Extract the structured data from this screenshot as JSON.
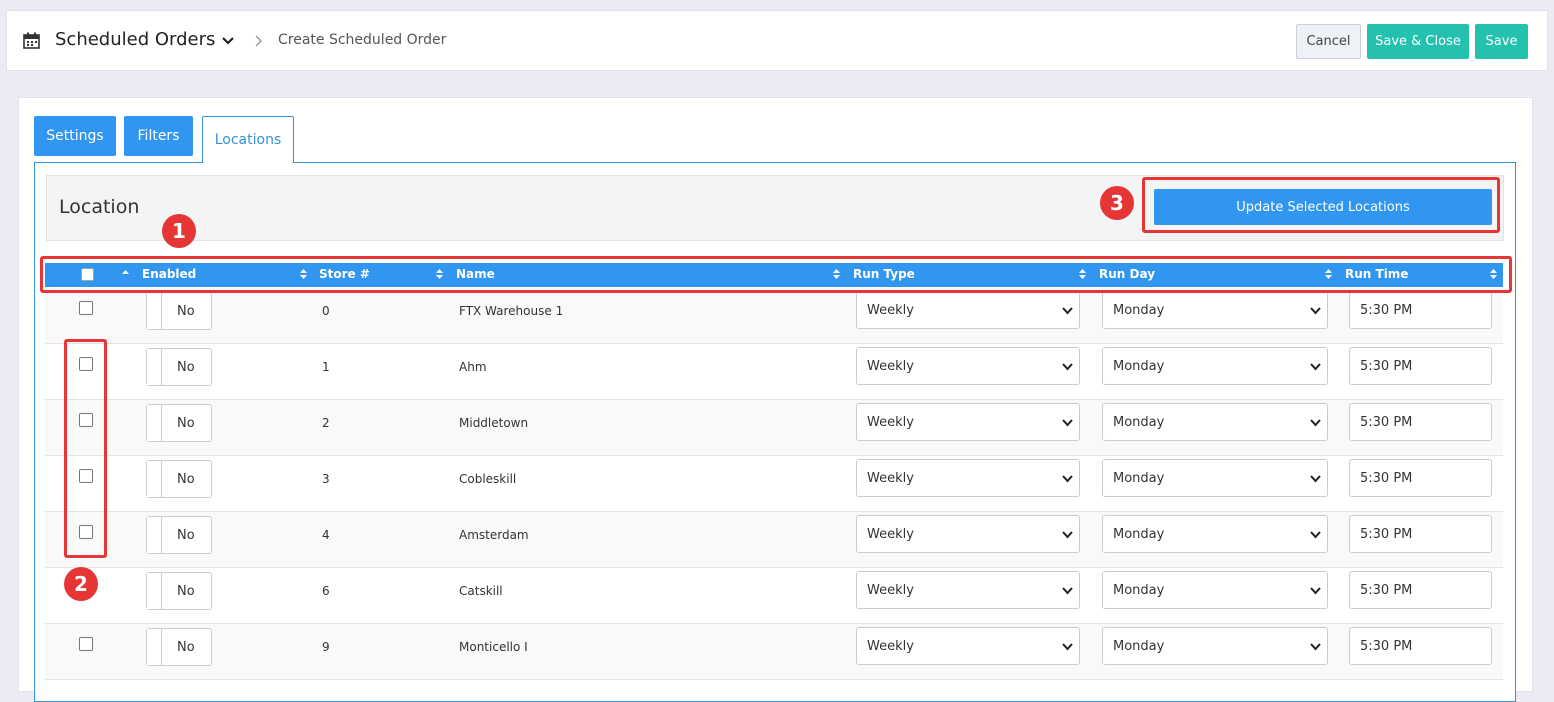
{
  "header": {
    "title": "Scheduled Orders",
    "breadcrumb_current": "Create Scheduled Order",
    "buttons": {
      "cancel": "Cancel",
      "save_close": "Save & Close",
      "save": "Save"
    }
  },
  "tabs": [
    {
      "label": "Settings"
    },
    {
      "label": "Filters"
    },
    {
      "label": "Locations",
      "active": true
    }
  ],
  "location_panel": {
    "title": "Location",
    "update_button": "Update Selected Locations"
  },
  "callouts": [
    "1",
    "2",
    "3"
  ],
  "table": {
    "columns": [
      "Enabled",
      "Store #",
      "Name",
      "Run Type",
      "Run Day",
      "Run Time"
    ],
    "rows": [
      {
        "enabled": "No",
        "store": "0",
        "name": "FTX Warehouse 1",
        "run_type": "Weekly",
        "run_day": "Monday",
        "run_time": "5:30 PM"
      },
      {
        "enabled": "No",
        "store": "1",
        "name": "Ahm",
        "run_type": "Weekly",
        "run_day": "Monday",
        "run_time": "5:30 PM"
      },
      {
        "enabled": "No",
        "store": "2",
        "name": "Middletown",
        "run_type": "Weekly",
        "run_day": "Monday",
        "run_time": "5:30 PM"
      },
      {
        "enabled": "No",
        "store": "3",
        "name": "Cobleskill",
        "run_type": "Weekly",
        "run_day": "Monday",
        "run_time": "5:30 PM"
      },
      {
        "enabled": "No",
        "store": "4",
        "name": "Amsterdam",
        "run_type": "Weekly",
        "run_day": "Monday",
        "run_time": "5:30 PM"
      },
      {
        "enabled": "No",
        "store": "6",
        "name": "Catskill",
        "run_type": "Weekly",
        "run_day": "Monday",
        "run_time": "5:30 PM"
      },
      {
        "enabled": "No",
        "store": "9",
        "name": "Monticello I",
        "run_type": "Weekly",
        "run_day": "Monday",
        "run_time": "5:30 PM"
      }
    ]
  },
  "colors": {
    "primary": "#3196ef",
    "teal": "#23c1ae",
    "annotation_red": "#e53535"
  }
}
